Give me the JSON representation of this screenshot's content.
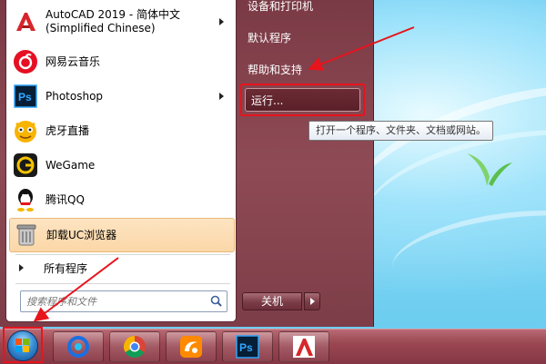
{
  "start_menu": {
    "programs": [
      {
        "label_line1": "AutoCAD 2019 - 简体中文",
        "label_line2": "(Simplified Chinese)",
        "icon": "autocad-icon",
        "has_submenu": true
      },
      {
        "label": "网易云音乐",
        "icon": "netease-music-icon",
        "has_submenu": false
      },
      {
        "label": "Photoshop",
        "icon": "photoshop-icon",
        "has_submenu": true
      },
      {
        "label": "虎牙直播",
        "icon": "huya-icon",
        "has_submenu": false
      },
      {
        "label": "WeGame",
        "icon": "wegame-icon",
        "has_submenu": false
      },
      {
        "label": "腾讯QQ",
        "icon": "qq-icon",
        "has_submenu": false
      },
      {
        "label": "卸载UC浏览器",
        "icon": "uninstall-uc-icon",
        "has_submenu": false,
        "highlighted": true
      }
    ],
    "all_programs_label": "所有程序",
    "search": {
      "placeholder": "搜索程序和文件"
    },
    "right_items": {
      "devices_printers": "设备和打印机",
      "default_programs": "默认程序",
      "help_support": "帮助和支持",
      "run": "运行..."
    },
    "tooltip": "打开一个程序、文件夹、文档或网站。",
    "shutdown_label": "关机"
  },
  "taskbar": {
    "pinned": [
      {
        "name": "baidu-netdisk-icon"
      },
      {
        "name": "chrome-icon"
      },
      {
        "name": "uc-browser-icon"
      },
      {
        "name": "photoshop-icon"
      },
      {
        "name": "autocad-icon"
      }
    ],
    "ps_text": "Ps",
    "acad_text": "A"
  },
  "colors": {
    "highlight_border": "#e8141c",
    "annotation_arrow": "#e8141c",
    "menu_right_bg": "#8e4b55",
    "taskbar": "#9a4752"
  }
}
